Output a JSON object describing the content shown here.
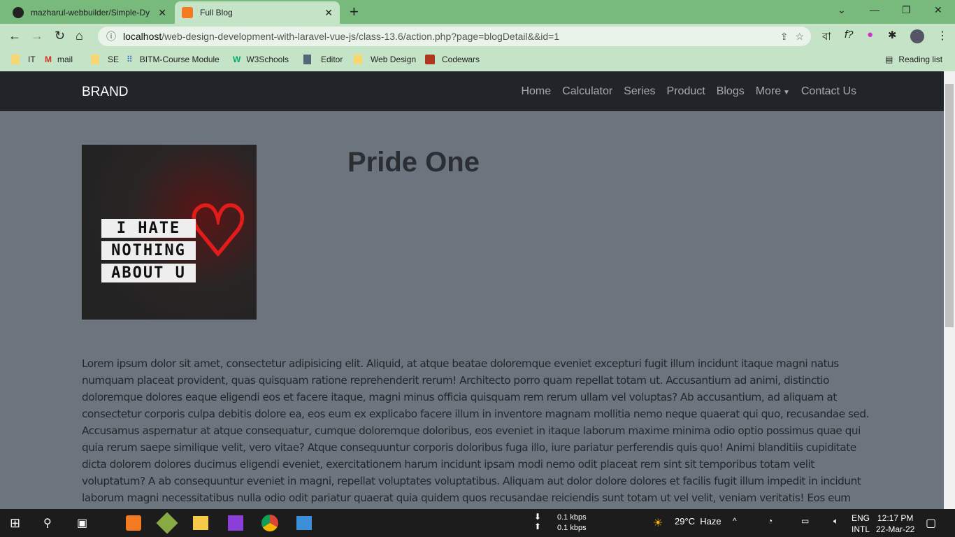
{
  "browser": {
    "tabs": [
      {
        "title": "mazharul-webbuilder/Simple-Dy",
        "active": false
      },
      {
        "title": "Full Blog",
        "active": true
      }
    ],
    "url_host": "localhost",
    "url_path": "/web-design-development-with-laravel-vue-js/class-13.6/action.php?page=blogDetail&&id=1",
    "bookmarks": [
      "IT",
      "mail",
      "SE",
      "BITM-Course Module",
      "W3Schools",
      "Editor",
      "Web Design",
      "Codewars"
    ],
    "reading_list": "Reading list"
  },
  "navbar": {
    "brand": "BRAND",
    "links": [
      "Home",
      "Calculator",
      "Series",
      "Product",
      "Blogs",
      "More",
      "Contact Us"
    ]
  },
  "post": {
    "title": "Pride One",
    "image_text": [
      "I HATE",
      "NOTHING",
      "ABOUT U"
    ],
    "body_lines": [
      "Lorem ipsum dolor sit amet, consectetur adipisicing elit. Aliquid, at atque beatae doloremque eveniet excepturi fugit illum incidunt itaque magni natus",
      "numquam placeat provident, quas quisquam ratione reprehenderit rerum! Architecto porro quam repellat totam ut. Accusantium ad animi, distinctio",
      "doloremque dolores eaque eligendi eos et facere itaque, magni minus officia quisquam rem rerum ullam vel voluptas? Ab accusantium, ad aliquam at",
      "consectetur corporis culpa debitis dolore ea, eos eum ex explicabo facere illum in inventore magnam mollitia nemo neque quaerat qui quo, recusandae sed.",
      "Accusamus aspernatur at atque consequatur, cumque doloremque doloribus, eos eveniet in itaque laborum maxime minima odio optio possimus quae qui",
      "quia rerum saepe similique velit, vero vitae? Atque consequuntur corporis doloribus fuga illo, iure pariatur perferendis quis quo! Animi blanditiis cupiditate",
      "dicta dolorem dolores ducimus eligendi eveniet, exercitationem harum incidunt ipsam modi nemo odit placeat rem sint sit temporibus totam velit",
      "voluptatum? A ab consequuntur eveniet in magni, repellat voluptates voluptatibus. Aliquam aut dolor dolore dolores et facilis fugit illum impedit in incidunt",
      "laborum magni necessitatibus nulla odio odit pariatur quaerat quia quidem quos recusandae reiciendis sunt totam ut vel velit, veniam veritatis! Eos eum"
    ]
  },
  "taskbar": {
    "net_down": "0.1 kbps",
    "net_up": "0.1 kbps",
    "weather": "29°C",
    "weather_desc": "Haze",
    "lang": "ENG",
    "lang2": "INTL",
    "time": "12:17 PM",
    "date": "22-Mar-22"
  },
  "colors": {
    "navbar": "#212529",
    "page_bg": "#6c757d",
    "chrome": "#78b97c"
  }
}
